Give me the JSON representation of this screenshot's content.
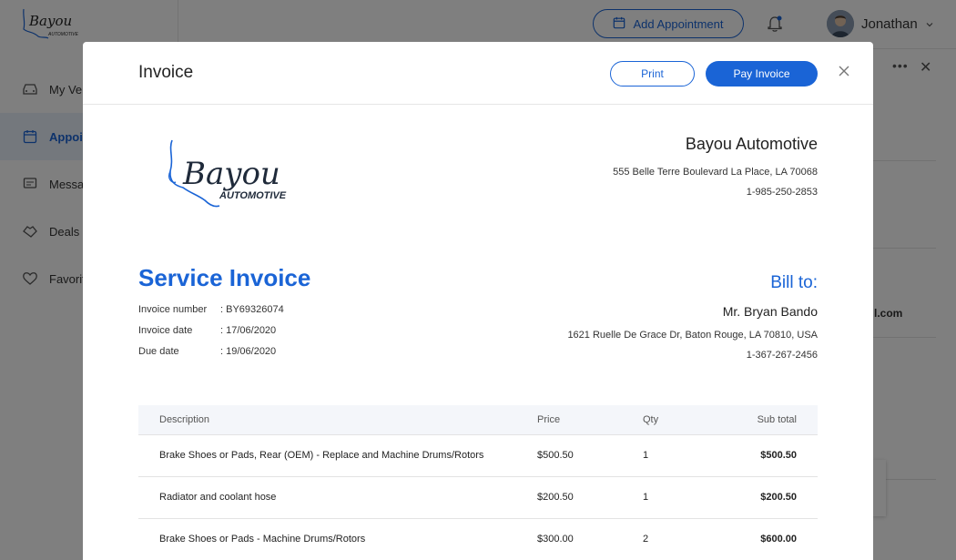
{
  "app": {
    "header": {
      "add_appointment_label": "Add Appointment",
      "user_name": "Jonathan"
    },
    "sidebar": {
      "items": [
        {
          "label": "My Vehicles",
          "icon": "car-icon"
        },
        {
          "label": "Appointments",
          "icon": "calendar-icon",
          "active": true
        },
        {
          "label": "Messages",
          "icon": "message-icon"
        },
        {
          "label": "Deals",
          "icon": "deal-icon"
        },
        {
          "label": "Favorites",
          "icon": "heart-icon"
        }
      ]
    },
    "background_partial_text": "l.com"
  },
  "modal": {
    "title": "Invoice",
    "print_label": "Print",
    "pay_label": "Pay Invoice"
  },
  "company": {
    "name": "Bayou Automotive",
    "address": "555 Belle Terre Boulevard La Place, LA 70068",
    "phone": "1-985-250-2853"
  },
  "logo": {
    "text_top": "Bayou",
    "text_bottom": "AUTOMOTIVE"
  },
  "invoice": {
    "title": "Service Invoice",
    "number_label": "Invoice number",
    "number": ": BY69326074",
    "date_label": "Invoice date",
    "date": ": 17/06/2020",
    "due_label": "Due date",
    "due": ": 19/06/2020"
  },
  "bill_to": {
    "title": "Bill to:",
    "name": "Mr. Bryan Bando",
    "address": "1621 Ruelle De Grace Dr, Baton Rouge, LA 70810, USA",
    "phone": "1-367-267-2456"
  },
  "table": {
    "headers": {
      "description": "Description",
      "price": "Price",
      "qty": "Qty",
      "subtotal": "Sub total"
    },
    "rows": [
      {
        "description": "Brake Shoes or Pads, Rear (OEM) - Replace and Machine Drums/Rotors",
        "price": "$500.50",
        "qty": "1",
        "subtotal": "$500.50"
      },
      {
        "description": "Radiator and coolant hose",
        "price": "$200.50",
        "qty": "1",
        "subtotal": "$200.50"
      },
      {
        "description": "Brake Shoes or Pads - Machine Drums/Rotors",
        "price": "$300.00",
        "qty": "2",
        "subtotal": "$600.00"
      }
    ]
  },
  "colors": {
    "accent": "#1a64d6",
    "overlay": "rgba(0,0,0,0.5)"
  }
}
